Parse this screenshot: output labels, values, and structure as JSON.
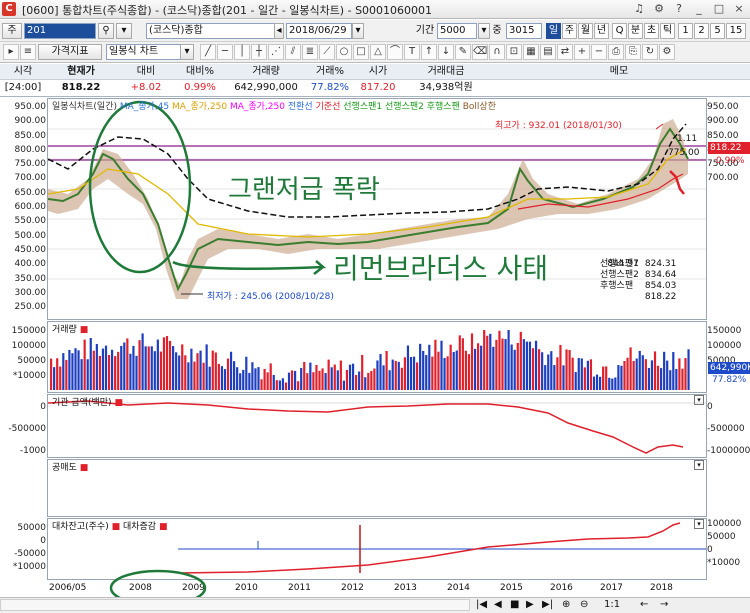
{
  "window": {
    "title": "[0600] 통합차트(주식종합) - (코스닥)종합(201 - 일간 - 일봉식차트) - S0001060001",
    "logo": "C",
    "controls": [
      "♫",
      "⚙",
      "?",
      "_",
      "□",
      "×"
    ]
  },
  "toolbar1": {
    "code_label": "주",
    "code_value": "201",
    "market_name": "(코스닥)종합",
    "date_value": "2018/06/29",
    "period_label": "기간",
    "period_value": "5000",
    "count_value": "3015",
    "count_suffix": "중",
    "periods": [
      "일",
      "주",
      "월",
      "년",
      "Q",
      "분",
      "초",
      "틱",
      "1",
      "2",
      "5",
      "15"
    ]
  },
  "toolbar2": {
    "price_index_btn": "가격지표",
    "chart_type_value": "일봉식 차트"
  },
  "info": {
    "headers": [
      "시각",
      "현재가",
      "대비",
      "대비%",
      "거래량",
      "거래%",
      "시가",
      "거래대금",
      "메모"
    ],
    "values": [
      "[24:00]",
      "818.22",
      "+8.02",
      "0.99%",
      "642,990,000",
      "77.82%",
      "817.20",
      "34,938억원",
      ""
    ]
  },
  "price_pane": {
    "legend": [
      {
        "text": "일봉식차트(일간)",
        "color": "#333333"
      },
      {
        "text": "MA_종가,45",
        "color": "#2a6fd8"
      },
      {
        "text": "MA_종가,250",
        "color": "#d8a000"
      },
      {
        "text": "MA_종가,250",
        "color": "#ff00ff"
      },
      {
        "text": "전환선",
        "color": "#2a6fd8"
      },
      {
        "text": "기준선",
        "color": "#e0202b"
      },
      {
        "text": "선행스팬1",
        "color": "#1a9a1a"
      },
      {
        "text": "선행스팬2",
        "color": "#1a9a1a"
      },
      {
        "text": "후행스팬",
        "color": "#1a9a1a"
      },
      {
        "text": "Boll상한",
        "color": "#8b5a2b"
      }
    ],
    "high_label": "최고가 : 932.01 (2018/01/30)",
    "low_label": "최저가 : 245.06 (2008/10/28)",
    "left_axis": [
      "950.00",
      "900.00",
      "850.00",
      "800.00",
      "750.00",
      "700.00",
      "650.00",
      "600.00",
      "550.00",
      "500.00",
      "450.00",
      "400.00",
      "350.00",
      "300.00",
      "250.00"
    ],
    "right_axis": [
      "950.00",
      "900.00",
      "850.00",
      "800.00",
      "750.00",
      "700.00"
    ],
    "current_tag": "818.22",
    "pct_tag": "0.99%",
    "mini_labels": [
      "1.11",
      "775.00"
    ],
    "stats": [
      {
        "name": "",
        "value": "824.31"
      },
      {
        "name": "",
        "value": "844.97"
      },
      {
        "name": "선행스팬1",
        "value": "834.64"
      },
      {
        "name": "선행스팬2",
        "value": "854.03"
      },
      {
        "name": "후행스팬",
        "value": "818.22"
      }
    ],
    "annotation_top": "그랜저급 폭락",
    "annotation_bottom": "리먼브라더스 사태"
  },
  "volume_pane": {
    "legend": "거래량",
    "left_axis": [
      "150000",
      "100000",
      "50000",
      "*10000"
    ],
    "right_axis": [
      "150000",
      "100000",
      "50000"
    ],
    "current_tag": "642,990K",
    "pct_tag": "77.82%"
  },
  "investor_pane": {
    "legend": "기관 금액(백만)",
    "left_axis": [
      "0",
      "-500000",
      "-1000"
    ],
    "right_axis": [
      "0",
      "-500000",
      "-1000000"
    ],
    "unit_left": "*10",
    "unit_right": "*10"
  },
  "short_pane": {
    "legend": "공매도"
  },
  "loan_pane": {
    "legend_a": "대차잔고(주수)",
    "legend_b": "대차증감",
    "left_axis": [
      "50000",
      "0",
      "-50000",
      "*10000"
    ],
    "right_axis": [
      "100000",
      "50000",
      "0",
      "*10000"
    ]
  },
  "x_axis": [
    "2006/05",
    "2008",
    "2009",
    "2010",
    "2011",
    "2012",
    "2013",
    "2014",
    "2015",
    "2016",
    "2017",
    "2018"
  ],
  "bottombar": {
    "scale": "1:1",
    "icons": [
      "|◀",
      "◀",
      "■",
      "▶",
      "▶|",
      "⊕",
      "⊖",
      "←",
      "→"
    ]
  }
}
